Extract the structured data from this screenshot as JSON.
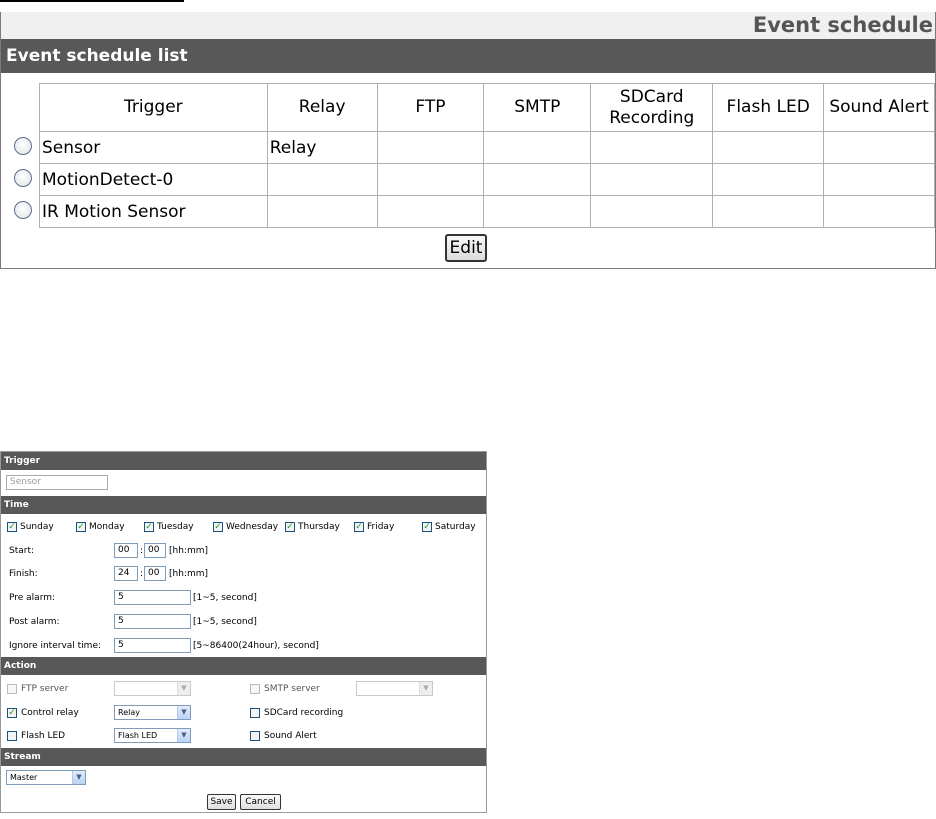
{
  "header": {
    "title": "Event schedule"
  },
  "list": {
    "title": "Event schedule list",
    "columns": [
      "Trigger",
      "Relay",
      "FTP",
      "SMTP",
      "SDCard Recording",
      "Flash LED",
      "Sound Alert"
    ],
    "rows": [
      [
        "Sensor",
        "Relay",
        "",
        "",
        "",
        "",
        ""
      ],
      [
        "MotionDetect-0",
        "",
        "",
        "",
        "",
        "",
        ""
      ],
      [
        "IR Motion Sensor",
        "",
        "",
        "",
        "",
        "",
        ""
      ]
    ],
    "edit_label": "Edit"
  },
  "form": {
    "trigger": {
      "section": "Trigger",
      "value": "Sensor"
    },
    "time": {
      "section": "Time",
      "days": [
        "Sunday",
        "Monday",
        "Tuesday",
        "Wednesday",
        "Thursday",
        "Friday",
        "Saturday"
      ],
      "days_checked": [
        true,
        true,
        true,
        true,
        true,
        true,
        true
      ],
      "start_label": "Start:",
      "start_h": "00",
      "start_m": "00",
      "finish_label": "Finish:",
      "finish_h": "24",
      "finish_m": "00",
      "colon": ":",
      "hhmm": "[hh:mm]",
      "pre_label": "Pre alarm:",
      "pre_value": "5",
      "pre_hint": "[1~5, second]",
      "post_label": "Post alarm:",
      "post_value": "5",
      "post_hint": "[1~5, second]",
      "ignore_label": "Ignore interval time:",
      "ignore_value": "5",
      "ignore_hint": "[5~86400(24hour), second]"
    },
    "action": {
      "section": "Action",
      "ftp_label": "FTP server",
      "ftp_checked": false,
      "ftp_select": "",
      "smtp_label": "SMTP server",
      "smtp_checked": false,
      "smtp_select": "",
      "relay_label": "Control relay",
      "relay_checked": true,
      "relay_select": "Relay",
      "sdcard_label": "SDCard recording",
      "sdcard_checked": false,
      "flash_label": "Flash LED",
      "flash_checked": false,
      "flash_select": "Flash LED",
      "sound_label": "Sound Alert",
      "sound_checked": false
    },
    "stream": {
      "section": "Stream",
      "value": "Master"
    },
    "save_label": "Save",
    "cancel_label": "Cancel"
  },
  "icons": {
    "check": "checkmark-icon",
    "dropdown": "chevron-down-icon",
    "radio": "radio-icon"
  },
  "colors": {
    "bar": "#585858",
    "header_bg": "#f0f0f0",
    "check": "#21a121",
    "input_border": "#7f9db9"
  }
}
